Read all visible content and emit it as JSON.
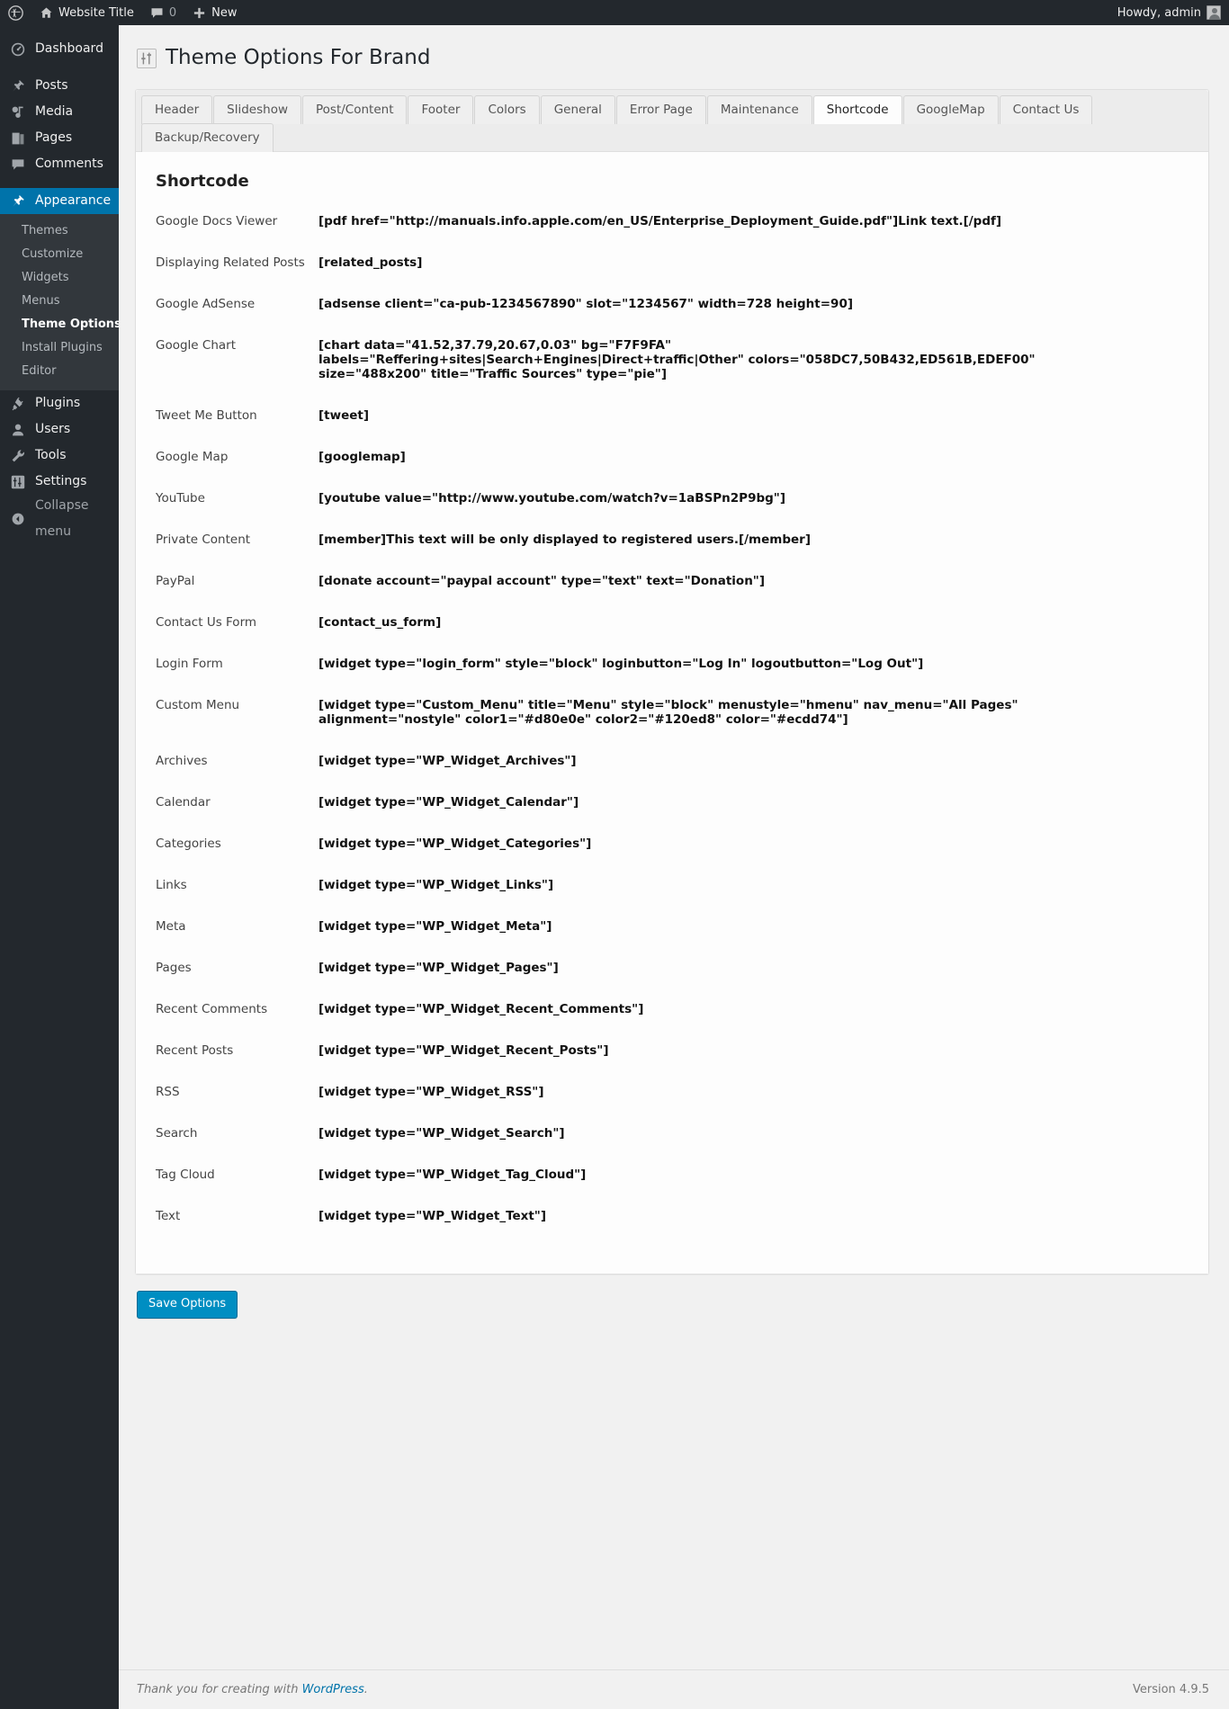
{
  "adminbar": {
    "wp_logo_icon": "wordpress-logo-icon",
    "site_icon": "home-icon",
    "site_title": "Website Title",
    "comments_icon": "comment-bubble-icon",
    "comments_count": "0",
    "new_icon": "plus-icon",
    "new_label": "New",
    "howdy": "Howdy, admin",
    "avatar_name": "avatar"
  },
  "sidebar": {
    "items": [
      {
        "label": "Dashboard",
        "icon": "dashboard-icon",
        "current": false
      },
      {
        "label": "Posts",
        "icon": "pin-icon",
        "current": false
      },
      {
        "label": "Media",
        "icon": "media-icon",
        "current": false
      },
      {
        "label": "Pages",
        "icon": "pages-icon",
        "current": false
      },
      {
        "label": "Comments",
        "icon": "comment-bubble-icon",
        "current": false
      },
      {
        "label": "Appearance",
        "icon": "paintbrush-icon",
        "current": true
      },
      {
        "label": "Plugins",
        "icon": "plug-icon",
        "current": false
      },
      {
        "label": "Users",
        "icon": "user-icon",
        "current": false
      },
      {
        "label": "Tools",
        "icon": "wrench-icon",
        "current": false
      },
      {
        "label": "Settings",
        "icon": "sliders-icon",
        "current": false
      }
    ],
    "submenu": [
      {
        "label": "Themes",
        "current": false
      },
      {
        "label": "Customize",
        "current": false
      },
      {
        "label": "Widgets",
        "current": false
      },
      {
        "label": "Menus",
        "current": false
      },
      {
        "label": "Theme Options",
        "current": true
      },
      {
        "label": "Install Plugins",
        "current": false
      },
      {
        "label": "Editor",
        "current": false
      }
    ],
    "collapse": {
      "label": "Collapse menu",
      "icon": "chevron-left-circle-icon"
    }
  },
  "page": {
    "title": "Theme Options For Brand",
    "title_icon": "sliders-icon"
  },
  "tabs": {
    "row1": [
      {
        "label": "Header",
        "active": false
      },
      {
        "label": "Slideshow",
        "active": false
      },
      {
        "label": "Post/Content",
        "active": false
      },
      {
        "label": "Footer",
        "active": false
      },
      {
        "label": "Colors",
        "active": false
      },
      {
        "label": "General",
        "active": false
      },
      {
        "label": "Error Page",
        "active": false
      },
      {
        "label": "Maintenance",
        "active": false
      },
      {
        "label": "Shortcode",
        "active": true
      },
      {
        "label": "GoogleMap",
        "active": false
      },
      {
        "label": "Contact Us",
        "active": false
      }
    ],
    "row2": [
      {
        "label": "Backup/Recovery",
        "active": false
      }
    ]
  },
  "section": {
    "title": "Shortcode",
    "rows": [
      {
        "label": "Google Docs Viewer",
        "code": [
          "[pdf href=\"http://manuals.info.apple.com/en_US/Enterprise_Deployment_Guide.pdf\"]Link text.[/pdf]"
        ]
      },
      {
        "label": "Displaying Related Posts",
        "code": [
          "[related_posts]"
        ]
      },
      {
        "label": "Google AdSense",
        "code": [
          "[adsense client=\"ca-pub-1234567890\" slot=\"1234567\" width=728 height=90]"
        ]
      },
      {
        "label": "Google Chart",
        "code": [
          "[chart data=\"41.52,37.79,20.67,0.03\" bg=\"F7F9FA\"",
          "labels=\"Reffering+sites|Search+Engines|Direct+traffic|Other\" colors=\"058DC7,50B432,ED561B,EDEF00\"",
          "size=\"488x200\" title=\"Traffic Sources\" type=\"pie\"]"
        ]
      },
      {
        "label": "Tweet Me Button",
        "code": [
          "[tweet]"
        ]
      },
      {
        "label": "Google Map",
        "code": [
          "[googlemap]"
        ]
      },
      {
        "label": "YouTube",
        "code": [
          "[youtube value=\"http://www.youtube.com/watch?v=1aBSPn2P9bg\"]"
        ]
      },
      {
        "label": "Private Content",
        "code": [
          "[member]This text will be only displayed to registered users.[/member]"
        ]
      },
      {
        "label": "PayPal",
        "code": [
          "[donate account=\"paypal account\" type=\"text\" text=\"Donation\"]"
        ]
      },
      {
        "label": "Contact Us Form",
        "code": [
          "[contact_us_form]"
        ]
      },
      {
        "label": "Login Form",
        "code": [
          "[widget type=\"login_form\" style=\"block\" loginbutton=\"Log In\" logoutbutton=\"Log Out\"]"
        ]
      },
      {
        "label": "Custom Menu",
        "code": [
          "[widget type=\"Custom_Menu\" title=\"Menu\" style=\"block\" menustyle=\"hmenu\" nav_menu=\"All Pages\"",
          "alignment=\"nostyle\" color1=\"#d80e0e\" color2=\"#120ed8\" color=\"#ecdd74\"]"
        ]
      },
      {
        "label": "Archives",
        "code": [
          "[widget type=\"WP_Widget_Archives\"]"
        ]
      },
      {
        "label": "Calendar",
        "code": [
          "[widget type=\"WP_Widget_Calendar\"]"
        ]
      },
      {
        "label": "Categories",
        "code": [
          "[widget type=\"WP_Widget_Categories\"]"
        ]
      },
      {
        "label": "Links",
        "code": [
          "[widget type=\"WP_Widget_Links\"]"
        ]
      },
      {
        "label": "Meta",
        "code": [
          "[widget type=\"WP_Widget_Meta\"]"
        ]
      },
      {
        "label": "Pages",
        "code": [
          "[widget type=\"WP_Widget_Pages\"]"
        ]
      },
      {
        "label": "Recent Comments",
        "code": [
          "[widget type=\"WP_Widget_Recent_Comments\"]"
        ]
      },
      {
        "label": "Recent Posts",
        "code": [
          "[widget type=\"WP_Widget_Recent_Posts\"]"
        ]
      },
      {
        "label": "RSS",
        "code": [
          "[widget type=\"WP_Widget_RSS\"]"
        ]
      },
      {
        "label": "Search",
        "code": [
          "[widget type=\"WP_Widget_Search\"]"
        ]
      },
      {
        "label": "Tag Cloud",
        "code": [
          "[widget type=\"WP_Widget_Tag_Cloud\"]"
        ]
      },
      {
        "label": "Text",
        "code": [
          "[widget type=\"WP_Widget_Text\"]"
        ]
      }
    ]
  },
  "submit": {
    "label": "Save Options"
  },
  "footer": {
    "thanks_prefix": "Thank you for creating with ",
    "link_label": "WordPress",
    "thanks_suffix": ".",
    "version": "Version 4.9.5"
  },
  "colors": {
    "admin_bar_bg": "#23282d",
    "sidebar_bg": "#23282d",
    "submenu_bg": "#32373c",
    "accent": "#0073aa",
    "button": "#008ec2",
    "page_bg": "#f1f1f1"
  }
}
